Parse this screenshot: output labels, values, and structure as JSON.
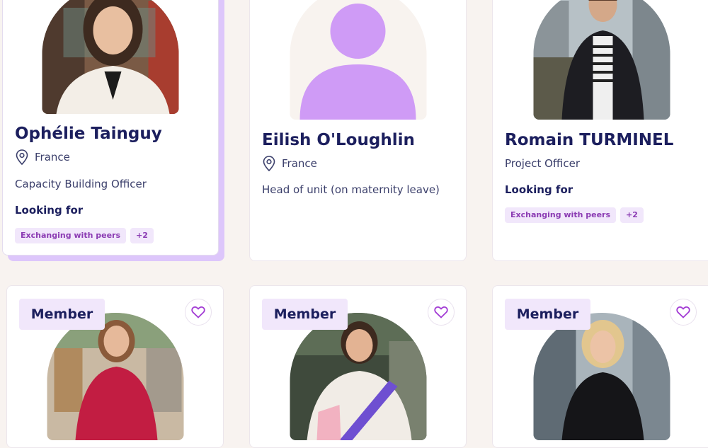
{
  "cards_top": [
    {
      "name": "Ophélie Tainguy",
      "location": "France",
      "role": "Capacity Building Officer",
      "looking_for_label": "Looking for",
      "tags": [
        "Exchanging with peers",
        "+2"
      ]
    },
    {
      "name": "Eilish O'Loughlin",
      "location": "France",
      "role": "Head of unit (on maternity leave)"
    },
    {
      "name": "Romain TURMINEL",
      "role": "Project Officer",
      "looking_for_label": "Looking for",
      "tags": [
        "Exchanging with peers",
        "+2"
      ]
    }
  ],
  "cards_bottom": [
    {
      "badge": "Member"
    },
    {
      "badge": "Member"
    },
    {
      "badge": "Member"
    }
  ],
  "colors": {
    "background": "#f8f3f0",
    "name_text": "#1c1f5e",
    "tag_bg": "#f1e7fb",
    "tag_text": "#8b3bb3",
    "placeholder_avatar": "#cf9bf6",
    "hover_shadow": "#ddc6fb",
    "heart": "#a23bd4"
  },
  "icons": {
    "location": "map-pin-icon",
    "favorite": "heart-outline-icon",
    "placeholder": "default-avatar-icon"
  }
}
